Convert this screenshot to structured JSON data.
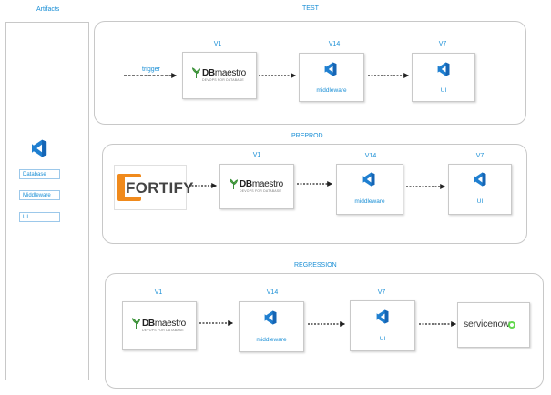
{
  "artifacts": {
    "title": "Artifacts",
    "items": [
      "Database",
      "Middleware",
      "UI"
    ]
  },
  "stages": {
    "test": {
      "title": "TEST",
      "trigger": "trigger",
      "db_version": "V1",
      "db_name": "DBmaestro",
      "db_tagline": "DEVOPS FOR DATABASE",
      "mw_version": "V14",
      "mw_label": "middleware",
      "ui_version": "V7",
      "ui_label": "UI"
    },
    "preprod": {
      "title": "PREPROD",
      "fortify": "FORTIFY",
      "db_version": "V1",
      "db_name": "DBmaestro",
      "db_tagline": "DEVOPS FOR DATABASE",
      "mw_version": "V14",
      "mw_label": "middleware",
      "ui_version": "V7",
      "ui_label": "UI"
    },
    "regression": {
      "title": "REGRESSION",
      "db_version": "V1",
      "db_name": "DBmaestro",
      "db_tagline": "DEVOPS FOR DATABASE",
      "mw_version": "V14",
      "mw_label": "middleware",
      "ui_version": "V7",
      "ui_label": "UI",
      "servicenow": "servicenow"
    }
  },
  "colors": {
    "accent": "#1a8fd6",
    "vs_blue": "#1f7fd0",
    "border": "#c8c8c8",
    "fortify_orange": "#f08a1c",
    "servicenow_green": "#62d84e"
  },
  "icons": [
    "visual-studio-icon",
    "dbmaestro-logo",
    "fortify-logo",
    "servicenow-logo"
  ]
}
